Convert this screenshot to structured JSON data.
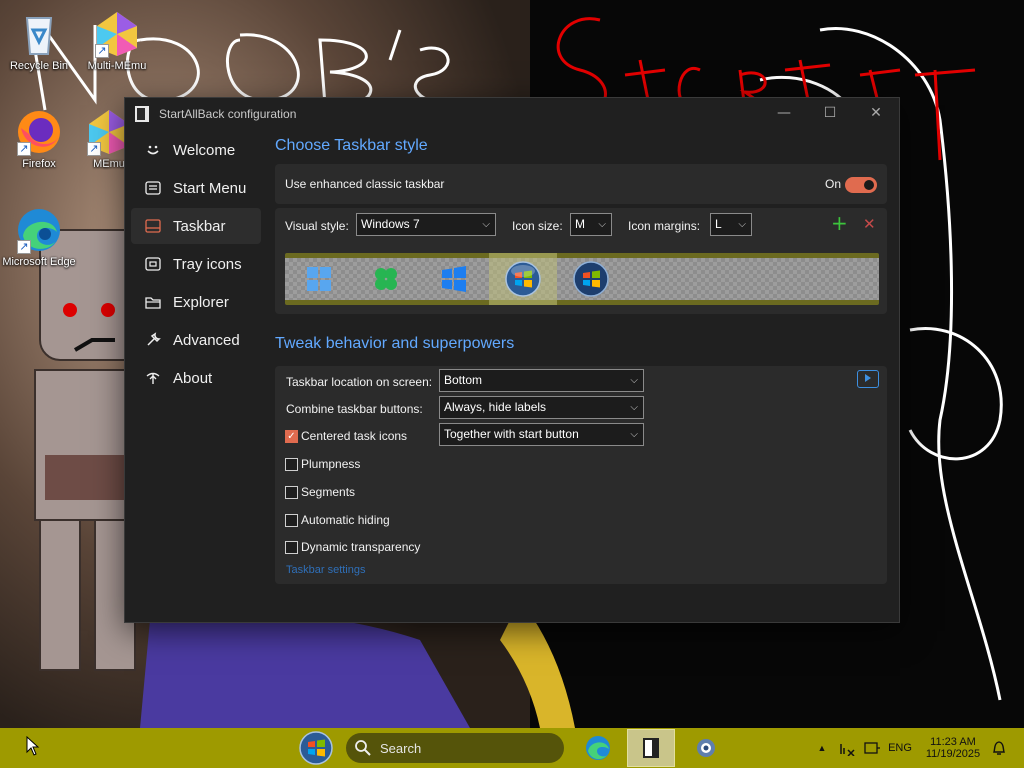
{
  "desktop": {
    "icons": [
      {
        "label": "Recycle Bin",
        "icon": "recycle-bin-icon"
      },
      {
        "label": "Multi-MEmu",
        "icon": "memu-icon"
      },
      {
        "label": "Firefox",
        "icon": "firefox-icon"
      },
      {
        "label": "MEmu",
        "icon": "memu-icon"
      },
      {
        "label": "Microsoft Edge",
        "icon": "edge-icon"
      }
    ]
  },
  "window": {
    "title": "StartAllBack configuration",
    "controls": {
      "minimize": "—",
      "maximize": "☐",
      "close": "✕"
    }
  },
  "sidebar": {
    "items": [
      {
        "label": "Welcome",
        "icon": "smile-icon"
      },
      {
        "label": "Start Menu",
        "icon": "start-menu-icon"
      },
      {
        "label": "Taskbar",
        "icon": "taskbar-icon",
        "active": true
      },
      {
        "label": "Tray icons",
        "icon": "tray-icon"
      },
      {
        "label": "Explorer",
        "icon": "folder-icon"
      },
      {
        "label": "Advanced",
        "icon": "wrench-icon"
      },
      {
        "label": "About",
        "icon": "about-icon"
      }
    ]
  },
  "taskbar_style": {
    "heading": "Choose Taskbar style",
    "enhanced_label": "Use enhanced classic taskbar",
    "enhanced_state": "On",
    "visual_style_label": "Visual style:",
    "visual_style_value": "Windows 7",
    "icon_size_label": "Icon size:",
    "icon_size_value": "M",
    "icon_margins_label": "Icon margins:",
    "icon_margins_value": "L",
    "add": "+",
    "remove": "✕",
    "start_buttons": [
      "windows-11-start-icon",
      "clover-start-icon",
      "windows-10-start-icon",
      "windows-7-orb-icon",
      "windows-vista-orb-icon"
    ],
    "selected_start_button": 3
  },
  "tweaks": {
    "heading": "Tweak behavior and superpowers",
    "location_label": "Taskbar location on screen:",
    "location_value": "Bottom",
    "combine_label": "Combine taskbar buttons:",
    "combine_value": "Always, hide labels",
    "centered_label": "Centered task icons",
    "centered_value": "Together with start button",
    "checks": [
      {
        "label": "Centered task icons",
        "checked": true
      },
      {
        "label": "Plumpness",
        "checked": false
      },
      {
        "label": "Segments",
        "checked": false
      },
      {
        "label": "Automatic hiding",
        "checked": false
      },
      {
        "label": "Dynamic transparency",
        "checked": false
      }
    ],
    "settings_link": "Taskbar settings"
  },
  "taskbar": {
    "search_placeholder": "Search",
    "tray": {
      "language": "ENG",
      "time": "11:23 AM",
      "date": "11/19/2025"
    },
    "colors": {
      "background": "#9e9a00",
      "accent": "#e06b4f",
      "link": "#62a9ff"
    }
  }
}
